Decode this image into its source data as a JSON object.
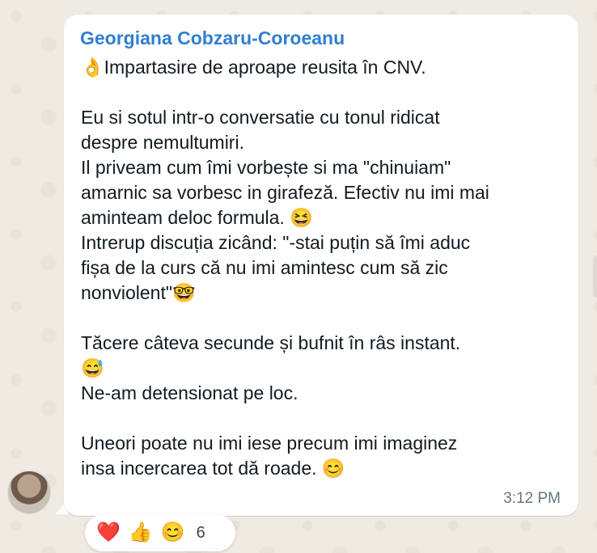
{
  "chat": {
    "sender_name": "Georgiana Cobzaru-Coroeanu",
    "message_text": "👌Impartasire de aproape reusita în CNV.\n\nEu si sotul intr-o conversatie cu tonul ridicat\ndespre  nemultumiri.\n Il priveam cum îmi  vorbește  si ma \"chinuiam\"\namarnic sa vorbesc in girafeză. Efectiv nu imi mai\naminteam deloc formula. 😆\nIntrerup discuția zicând: \"-stai puțin  să îmi aduc\nfișa de la curs că nu imi amintesc cum să zic\nnonviolent\"🤓\n\nTăcere câteva secunde și bufnit în râs instant.\n😅\nNe-am detensionat pe loc.\n\nUneori poate nu imi iese precum imi imaginez\ninsa incercarea tot dă roade. 😊",
    "timestamp": "3:12 PM"
  },
  "reactions": {
    "heart": "❤️",
    "thumbs_up": "👍",
    "smile": "😊",
    "count": "6"
  },
  "icons": {
    "avatar": "avatar-photo",
    "heart": "heart-icon",
    "thumbs_up": "thumbs-up-icon",
    "smile": "smiling-face-icon"
  }
}
